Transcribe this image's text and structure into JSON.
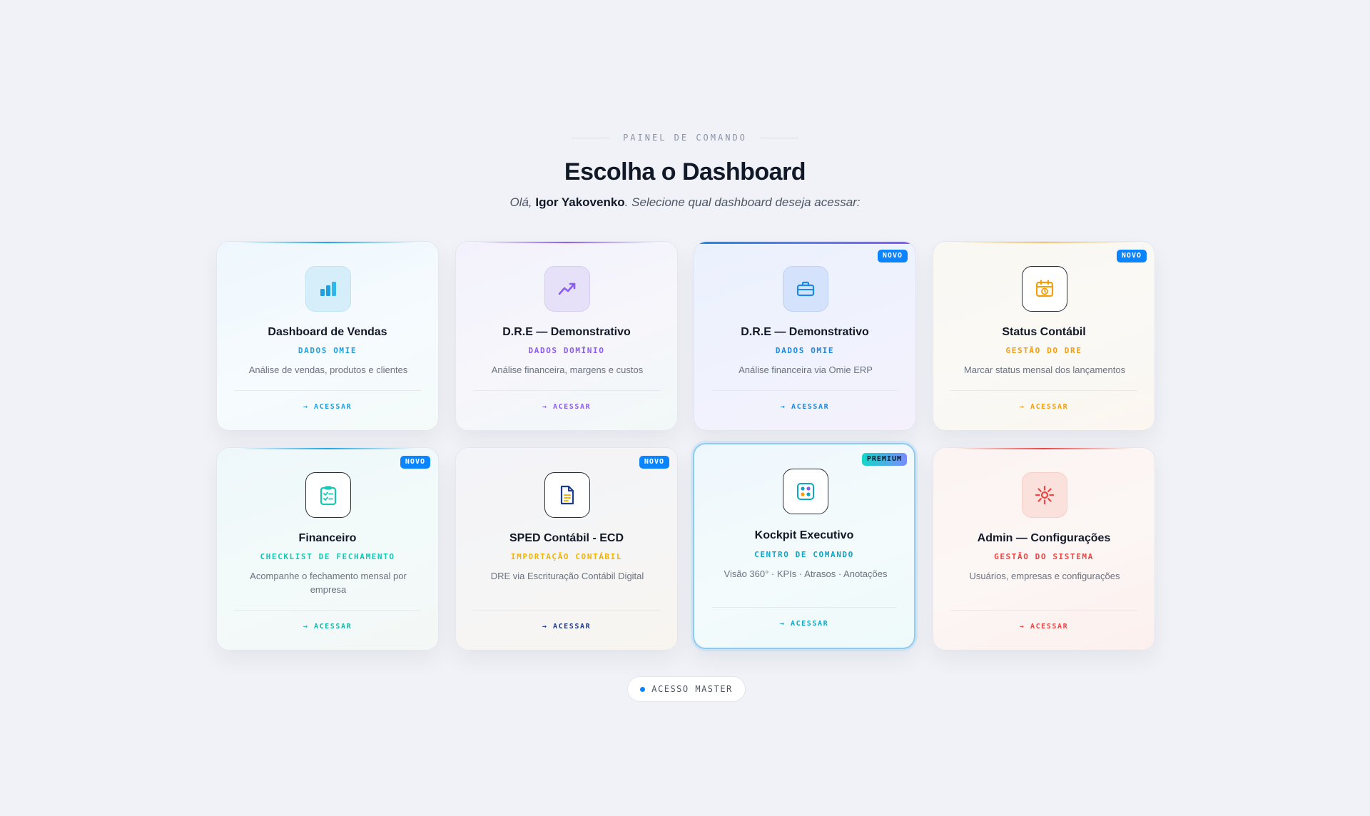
{
  "header": {
    "eyebrow": "PAINEL DE COMANDO",
    "title": "Escolha o Dashboard",
    "greeting_prefix": "Olá, ",
    "user_name": "Igor Yakovenko",
    "greeting_suffix": ". Selecione qual dashboard deseja acessar:"
  },
  "cards": [
    {
      "title": "Dashboard de Vendas",
      "subtitle": "DADOS OMIE",
      "description": "Análise de vendas, produtos e clientes",
      "action": "→ ACESSAR",
      "badge": "",
      "icon": "bar-chart-icon",
      "accent": "#1ea7e8"
    },
    {
      "title": "D.R.E — Demonstrativo",
      "subtitle": "DADOS DOMÍNIO",
      "description": "Análise financeira, margens e custos",
      "action": "→ ACESSAR",
      "badge": "",
      "icon": "trending-up-icon",
      "accent": "#8b5cf6"
    },
    {
      "title": "D.R.E — Demonstrativo",
      "subtitle": "DADOS OMIE",
      "description": "Análise financeira via Omie ERP",
      "action": "→ ACESSAR",
      "badge": "NOVO",
      "icon": "briefcase-icon",
      "accent": "#1e88e5"
    },
    {
      "title": "Status Contábil",
      "subtitle": "GESTÃO DO DRE",
      "description": "Marcar status mensal dos lançamentos",
      "action": "→ ACESSAR",
      "badge": "NOVO",
      "icon": "calendar-clock-icon",
      "accent": "#f59e0b"
    },
    {
      "title": "Financeiro",
      "subtitle": "CHECKLIST DE FECHAMENTO",
      "description": "Acompanhe o fechamento mensal por empresa",
      "action": "→ ACESSAR",
      "badge": "NOVO",
      "icon": "clipboard-check-icon",
      "accent": "#14c8b4"
    },
    {
      "title": "SPED Contábil - ECD",
      "subtitle": "IMPORTAÇÃO CONTÁBIL",
      "description": "DRE via Escrituração Contábil Digital",
      "action": "→ ACESSAR",
      "badge": "NOVO",
      "icon": "document-icon",
      "accent": "#f5b301"
    },
    {
      "title": "Kockpit Executivo",
      "subtitle": "CENTRO DE COMANDO",
      "description": "Visão 360° · KPIs · Atrasos · Anotações",
      "action": "→ ACESSAR",
      "badge": "PREMIUM",
      "icon": "control-grid-icon",
      "accent": "#0ea5c6"
    },
    {
      "title": "Admin — Configurações",
      "subtitle": "GESTÃO DO SISTEMA",
      "description": "Usuários, empresas e configurações",
      "action": "→ ACESSAR",
      "badge": "",
      "icon": "settings-sun-icon",
      "accent": "#ef4444"
    }
  ],
  "footer": {
    "master_label": "ACESSO MASTER"
  }
}
